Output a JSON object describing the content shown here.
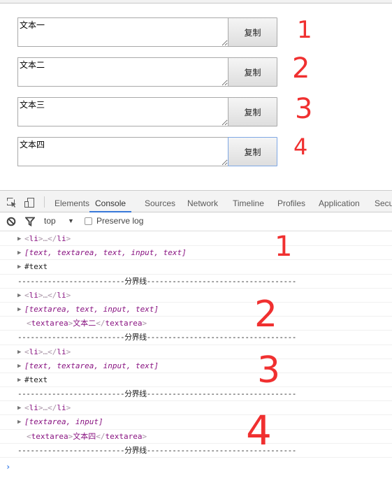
{
  "page": {
    "rows": [
      {
        "text": "文本一",
        "button": "复制"
      },
      {
        "text": "文本二",
        "button": "复制"
      },
      {
        "text": "文本三",
        "button": "复制"
      },
      {
        "text": "文本四",
        "button": "复制"
      }
    ],
    "annotations": [
      "1",
      "2",
      "3",
      "4"
    ]
  },
  "devtools": {
    "tabs": [
      "Elements",
      "Console",
      "Sources",
      "Network",
      "Timeline",
      "Profiles",
      "Application",
      "Secu"
    ],
    "active_tab": "Console",
    "filter": {
      "context": "top",
      "preserve_log_label": "Preserve log",
      "preserve_log_checked": false
    },
    "console": {
      "li_open": "<li>",
      "li_ellipsis": "…",
      "li_close": "</li>",
      "separator": "-------------------------分界线-----------------------------------",
      "groups": [
        {
          "array": "[text, textarea, text, input, text]",
          "third": "#text",
          "third_type": "node"
        },
        {
          "array": "[textarea, text, input, text]",
          "third": "文本二",
          "third_type": "textarea"
        },
        {
          "array": "[text, textarea, input, text]",
          "third": "#text",
          "third_type": "node"
        },
        {
          "array": "[textarea, input]",
          "third": "文本四",
          "third_type": "textarea"
        }
      ],
      "textarea_open": "<textarea>",
      "textarea_close": "</textarea>",
      "prompt": "›"
    },
    "annotations": [
      "1",
      "2",
      "3",
      "4"
    ]
  },
  "colors": {
    "accent": "#3879d9",
    "annotation": "#f03030",
    "tag_name": "#881280"
  }
}
